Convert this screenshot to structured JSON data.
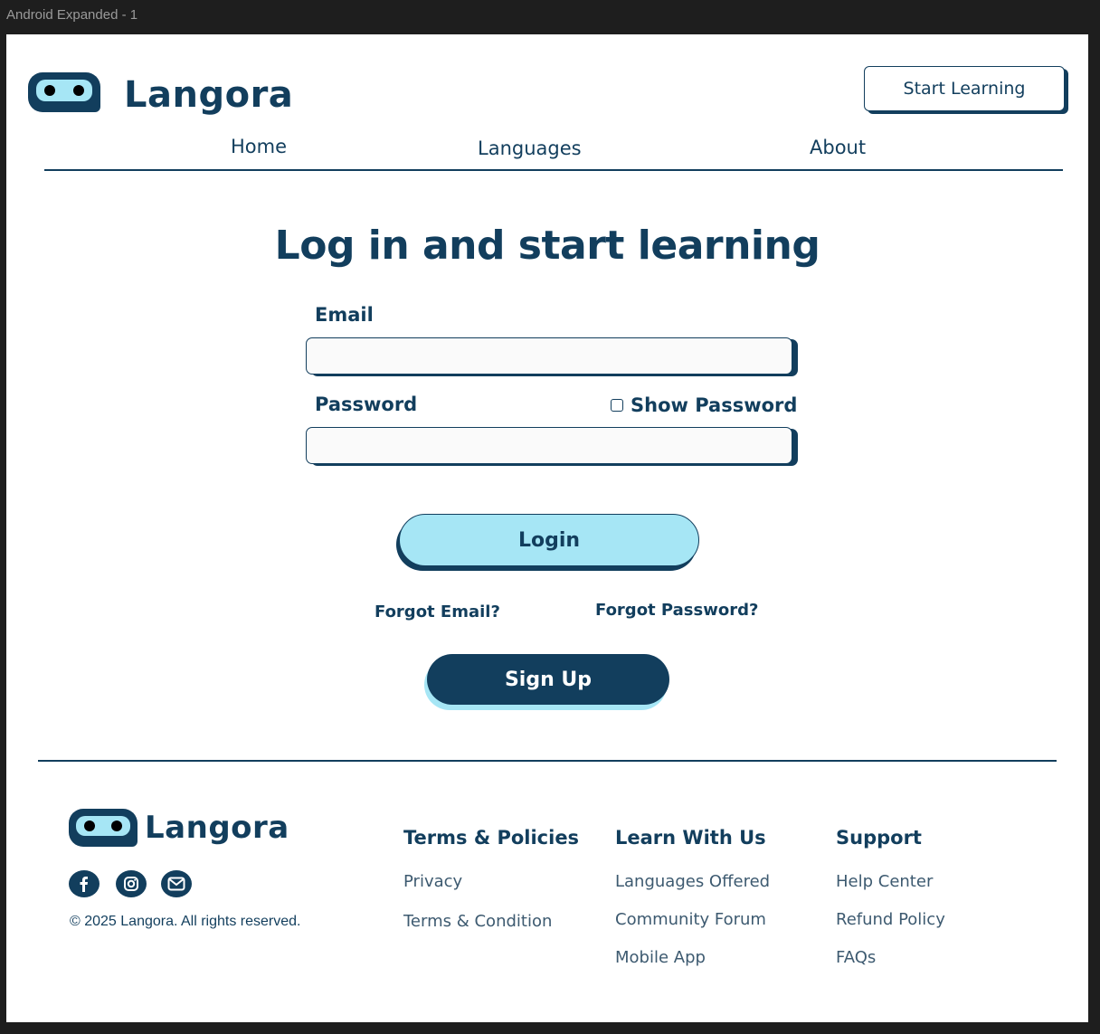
{
  "canvas": {
    "frame_label": "Android Expanded - 1"
  },
  "brand": {
    "name": "Langora"
  },
  "header": {
    "cta_label": "Start Learning"
  },
  "nav": {
    "items": [
      {
        "label": "Home"
      },
      {
        "label": "Languages"
      },
      {
        "label": "About"
      }
    ]
  },
  "main": {
    "title": "Log in and start learning",
    "email_label": "Email",
    "email_value": "",
    "password_label": "Password",
    "password_value": "",
    "show_password_label": "Show Password",
    "show_password_checked": false,
    "login_label": "Login",
    "forgot_email_label": "Forgot Email?",
    "forgot_password_label": "Forgot Password?",
    "signup_label": "Sign Up"
  },
  "footer": {
    "brand_name": "Langora",
    "social": [
      {
        "icon": "facebook-icon"
      },
      {
        "icon": "instagram-icon"
      },
      {
        "icon": "email-icon"
      }
    ],
    "copyright": "© 2025 Langora. All rights reserved.",
    "columns": [
      {
        "title": "Terms & Policies",
        "links": [
          "Privacy",
          "Terms & Condition"
        ]
      },
      {
        "title": "Learn With Us",
        "links": [
          "Languages Offered",
          "Community Forum",
          "Mobile App"
        ]
      },
      {
        "title": "Support",
        "links": [
          "Help Center",
          "Refund Policy",
          "FAQs"
        ]
      }
    ]
  },
  "colors": {
    "primary": "#123e5d",
    "accent": "#a6e6f5",
    "background": "#ffffff",
    "canvas": "#1e1e1e"
  }
}
